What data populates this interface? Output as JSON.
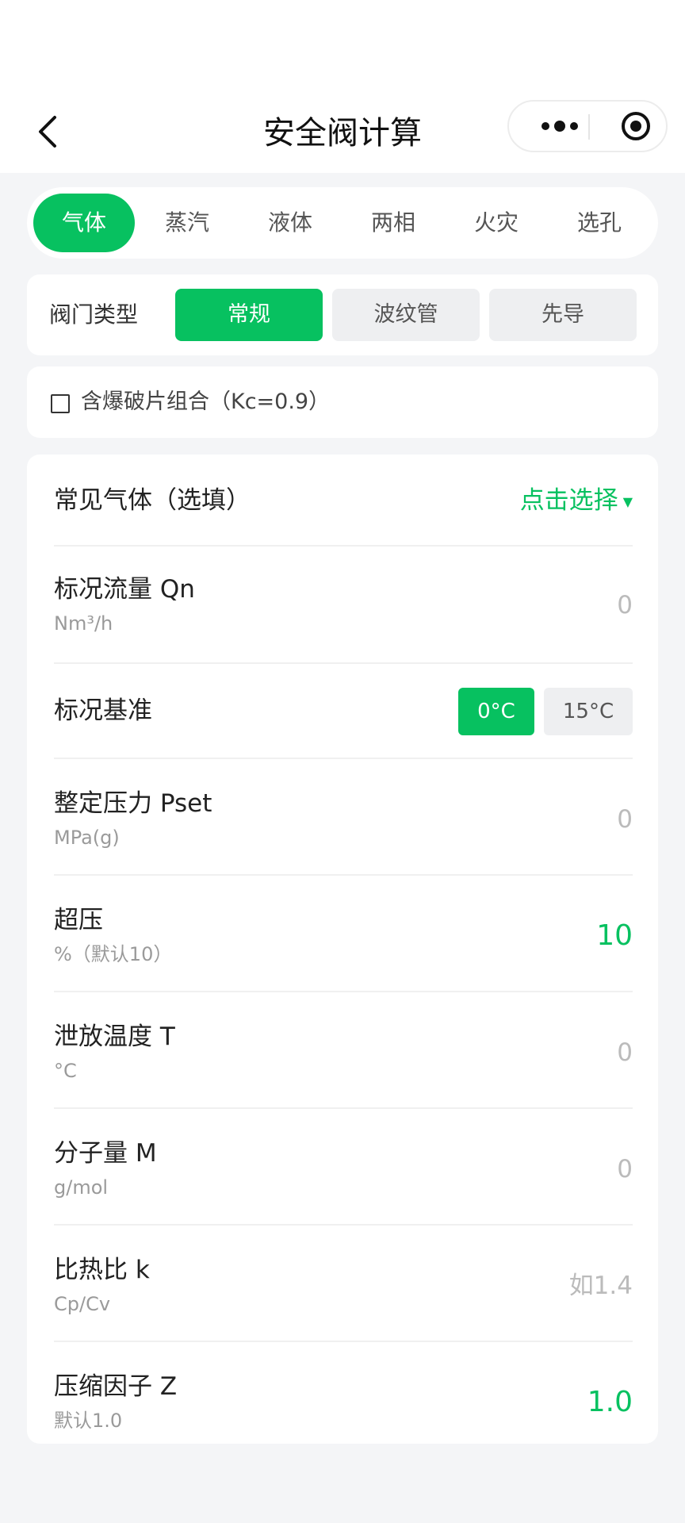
{
  "nav": {
    "title": "安全阀计算"
  },
  "tabs": [
    "气体",
    "蒸汽",
    "液体",
    "两相",
    "火灾",
    "选孔"
  ],
  "valve_type": {
    "label": "阀门类型",
    "options": [
      "常规",
      "波纹管",
      "先导"
    ]
  },
  "rupture_disc": {
    "label": "含爆破片组合（Kc=0.9）"
  },
  "form": {
    "common_gas": {
      "label": "常见气体（选填）",
      "picker": "点击选择"
    },
    "flow": {
      "label": "标况流量 Qn",
      "unit": "Nm³/h",
      "value": "0"
    },
    "std_ref": {
      "label": "标况基准",
      "options": [
        "0°C",
        "15°C"
      ]
    },
    "pset": {
      "label": "整定压力 Pset",
      "unit": "MPa(g)",
      "value": "0"
    },
    "overpressure": {
      "label": "超压",
      "unit": "%（默认10）",
      "value": "10"
    },
    "temp": {
      "label": "泄放温度 T",
      "unit": "°C",
      "value": "0"
    },
    "mw": {
      "label": "分子量 M",
      "unit": "g/mol",
      "value": "0"
    },
    "k": {
      "label": "比热比 k",
      "unit": "Cp/Cv",
      "placeholder": "如1.4"
    },
    "z": {
      "label": "压缩因子 Z",
      "unit": "默认1.0",
      "value": "1.0"
    }
  },
  "colors": {
    "accent": "#07c160",
    "background": "#f4f5f7",
    "placeholder": "#bbbbbb"
  },
  "icons": {
    "back": "chevron-left-icon",
    "more": "more-dots-icon",
    "close": "target-circle-icon",
    "caret": "caret-down-icon",
    "checkbox": "checkbox-unchecked-icon"
  }
}
